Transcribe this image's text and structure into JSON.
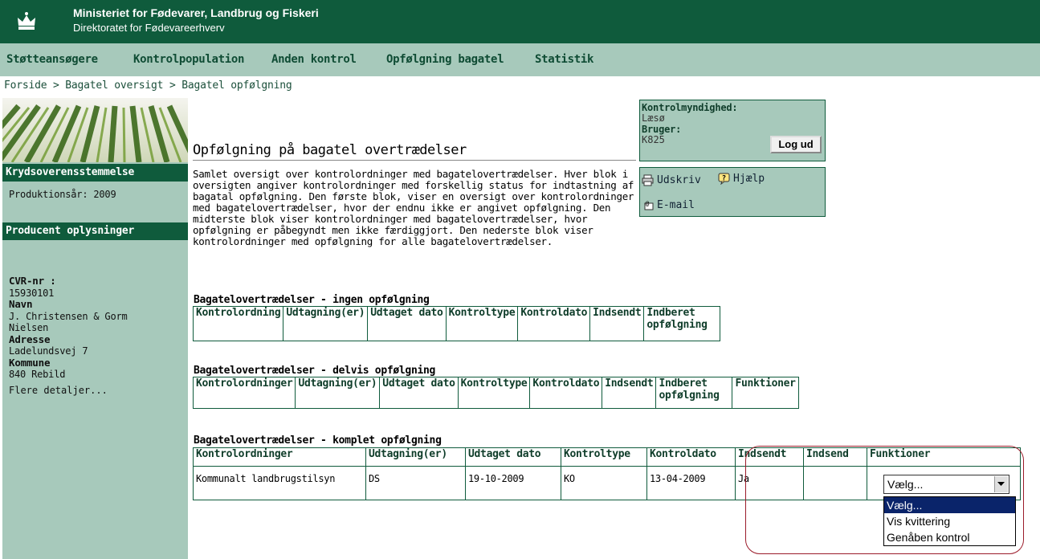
{
  "header": {
    "title": "Ministeriet for Fødevarer, Landbrug og Fiskeri",
    "subtitle": "Direktoratet for Fødevareerhverv",
    "logo_icon": "crown-icon"
  },
  "nav": {
    "items": [
      "Støtteansøgere",
      "Kontrolpopulation",
      "Anden kontrol",
      "Opfølgning bagatel",
      "Statistik"
    ]
  },
  "breadcrumb": [
    "Forside",
    "Bagatel oversigt",
    "Bagatel opfølgning"
  ],
  "sidebar": {
    "section1_title": "Krydsoverensstemmelse",
    "production_year": "Produktionsår: 2009",
    "section2_title": "Producent oplysninger",
    "cvr_label": "CVR-nr :",
    "cvr_value": "15930101",
    "name_label": "Navn",
    "name_value": "J. Christensen & Gorm Nielsen",
    "address_label": "Adresse",
    "address_value": "Ladelundsvej 7",
    "municipality_label": "Kommune",
    "municipality_value": "840 Rebild",
    "more_link": "Flere detaljer..."
  },
  "main": {
    "title": "Opfølgning på bagatel overtrædelser",
    "description": "Samlet oversigt over kontrolordninger med bagatelovertrædelser. Hver blok i oversigten angiver kontrolordninger med forskellig status for indtastning af bagatal opfølgning. Den første blok, viser en oversigt over kontrolordninger med bagatelovertrædelser, hvor der endnu ikke er angivet opfølgning. Den midterste blok viser kontrolordninger med bagatelovertrædelser, hvor opfølgning er påbegyndt men ikke færdiggjort. Den nederste blok viser kontrolordninger med opfølgning for alle bagatelovertrædelser."
  },
  "infobox": {
    "authority_label": "Kontrolmyndighed:",
    "authority_value": "Læsø",
    "user_label": "Bruger:",
    "user_value": "K825",
    "logout_label": "Log ud"
  },
  "tools": {
    "print": "Udskriv",
    "help": "Hjælp",
    "email": "E-mail"
  },
  "table1": {
    "title": "Bagatelovertrædelser - ingen opfølgning",
    "headers": [
      "Kontrolordning",
      "Udtagning(er)",
      "Udtaget dato",
      "Kontroltype",
      "Kontroldato",
      "Indsendt",
      "Indberet opfølgning"
    ]
  },
  "table2": {
    "title": "Bagatelovertrædelser - delvis opfølgning",
    "headers": [
      "Kontrolordninger",
      "Udtagning(er)",
      "Udtaget dato",
      "Kontroltype",
      "Kontroldato",
      "Indsendt",
      "Indberet opfølgning",
      "Funktioner"
    ]
  },
  "table3": {
    "title": "Bagatelovertrædelser - komplet opfølgning",
    "headers": [
      "Kontrolordninger",
      "Udtagning(er)",
      "Udtaget dato",
      "Kontroltype",
      "Kontroldato",
      "Indsendt",
      "Indsend",
      "Funktioner"
    ],
    "rows": [
      [
        "Kommunalt landbrugstilsyn",
        "DS",
        "19-10-2009",
        "KO",
        "13-04-2009",
        "Ja",
        ""
      ]
    ]
  },
  "select": {
    "value": "Vælg...",
    "options": [
      "Vælg...",
      "Vis kvittering",
      "Genåben kontrol"
    ],
    "highlighted_index": 0
  }
}
